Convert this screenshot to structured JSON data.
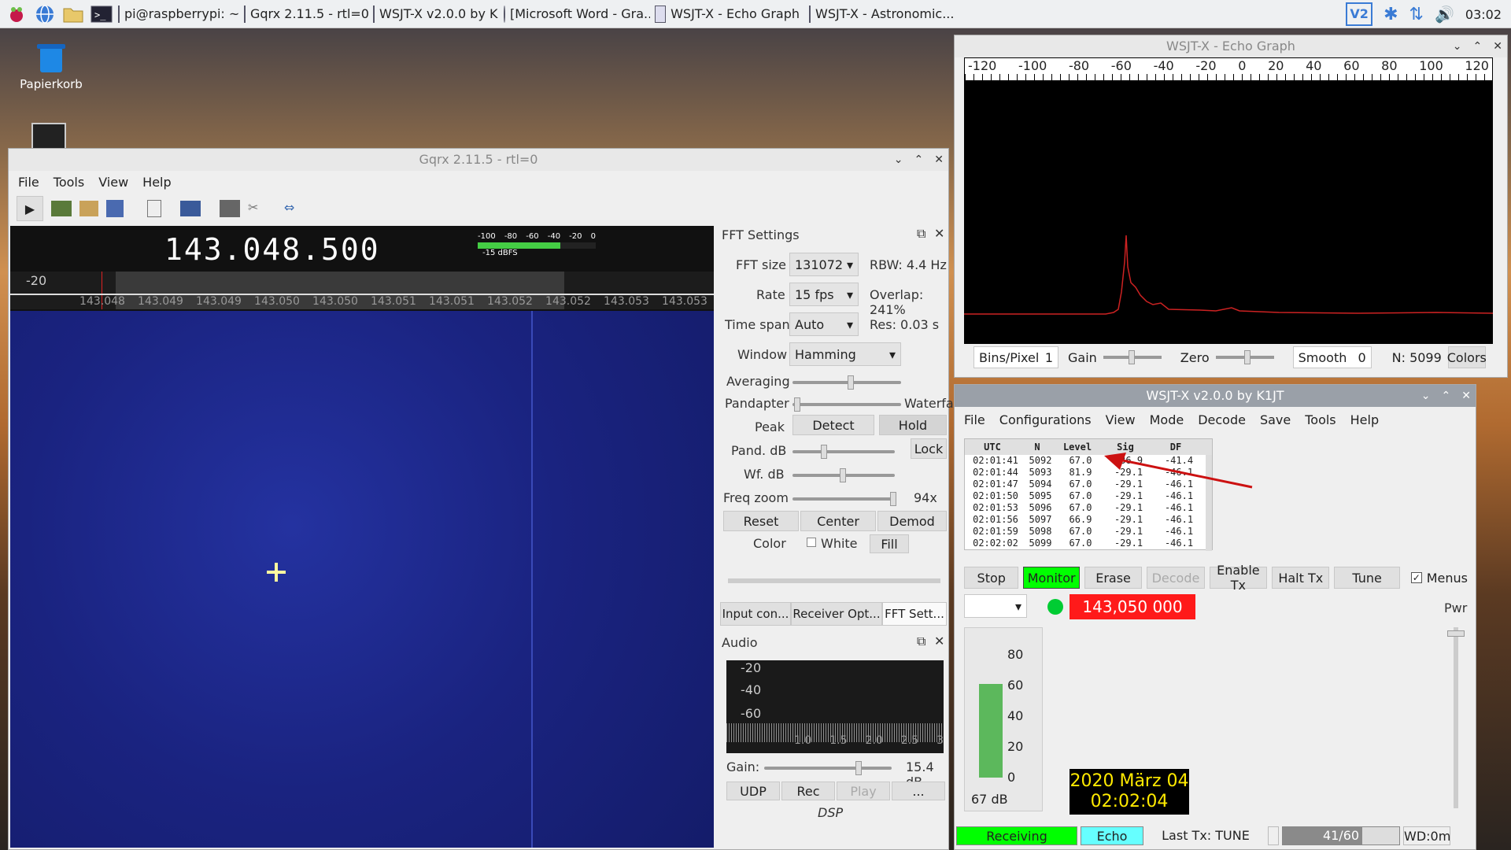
{
  "taskbar": {
    "tasks": [
      "pi@raspberrypi: ~",
      "Gqrx 2.11.5 - rtl=0",
      "WSJT-X   v2.0.0   by K...",
      "[Microsoft Word - Gra...",
      "WSJT-X - Echo Graph",
      "WSJT-X - Astronomic..."
    ],
    "clock": "03:02"
  },
  "desktop": {
    "trash_label": "Papierkorb"
  },
  "gqrx": {
    "title": "Gqrx 2.11.5 - rtl=0",
    "menu": [
      "File",
      "Tools",
      "View",
      "Help"
    ],
    "frequency": "143.048.500",
    "meter_scale": [
      "-100",
      "-80",
      "-60",
      "-40",
      "-20",
      "0"
    ],
    "meter_unit": "-15 dBFS",
    "plot_db": "-20",
    "freq_ticks": [
      "143.048",
      "143.049",
      "143.049",
      "143.050",
      "143.050",
      "143.051",
      "143.051",
      "143.052",
      "143.052",
      "143.053",
      "143.053"
    ],
    "fft": {
      "title": "FFT Settings",
      "fft_size_label": "FFT size",
      "fft_size": "131072",
      "rbw": "RBW: 4.4 Hz",
      "rate_label": "Rate",
      "rate": "15 fps",
      "overlap": "Overlap: 241%",
      "timespan_label": "Time span",
      "timespan": "Auto",
      "res": "Res: 0.03 s",
      "window_label": "Window",
      "window": "Hamming",
      "averaging_label": "Averaging",
      "pandapter_label": "Pandapter",
      "waterfall_label": "Waterfa",
      "peak_label": "Peak",
      "detect": "Detect",
      "hold": "Hold",
      "pand_db_label": "Pand. dB",
      "lock": "Lock",
      "wf_db_label": "Wf. dB",
      "freq_zoom_label": "Freq zoom",
      "freq_zoom": "94x",
      "reset": "Reset",
      "center": "Center",
      "demod": "Demod",
      "color_label": "Color",
      "white": "White",
      "fill": "Fill"
    },
    "tabs": [
      "Input con...",
      "Receiver Opt...",
      "FFT Sett..."
    ],
    "audio": {
      "title": "Audio",
      "db_ticks": [
        "-20",
        "-40",
        "-60"
      ],
      "khz_ticks": [
        "1.0",
        "1.5",
        "2.0",
        "2.5",
        "3"
      ],
      "gain_label": "Gain:",
      "gain_value": "15.4 dB",
      "udp": "UDP",
      "rec": "Rec",
      "play": "Play",
      "more": "...",
      "dsp": "DSP"
    }
  },
  "echo_graph": {
    "title": "WSJT-X - Echo Graph",
    "axis": [
      "-120",
      "-100",
      "-80",
      "-60",
      "-40",
      "-20",
      "0",
      "20",
      "40",
      "60",
      "80",
      "100",
      "120"
    ],
    "bins_label": "Bins/Pixel",
    "bins_value": "1",
    "gain_label": "Gain",
    "zero_label": "Zero",
    "smooth_label": "Smooth",
    "smooth_value": "0",
    "n_label": "N: 5099",
    "colors": "Colors"
  },
  "wsjtx": {
    "title": "WSJT-X   v2.0.0   by K1JT",
    "menu": [
      "File",
      "Configurations",
      "View",
      "Mode",
      "Decode",
      "Save",
      "Tools",
      "Help"
    ],
    "table_headers": [
      "UTC",
      "N",
      "Level",
      "Sig",
      "DF"
    ],
    "rows": [
      [
        "02:01:41",
        "5092",
        "67.0",
        "-36.9",
        "-41.4"
      ],
      [
        "02:01:44",
        "5093",
        "81.9",
        "-29.1",
        "-46.1"
      ],
      [
        "02:01:47",
        "5094",
        "67.0",
        "-29.1",
        "-46.1"
      ],
      [
        "02:01:50",
        "5095",
        "67.0",
        "-29.1",
        "-46.1"
      ],
      [
        "02:01:53",
        "5096",
        "67.0",
        "-29.1",
        "-46.1"
      ],
      [
        "02:01:56",
        "5097",
        "66.9",
        "-29.1",
        "-46.1"
      ],
      [
        "02:01:59",
        "5098",
        "67.0",
        "-29.1",
        "-46.1"
      ],
      [
        "02:02:02",
        "5099",
        "67.0",
        "-29.1",
        "-46.1"
      ]
    ],
    "buttons": {
      "stop": "Stop",
      "monitor": "Monitor",
      "erase": "Erase",
      "decode": "Decode",
      "enable_tx": "Enable Tx",
      "halt_tx": "Halt Tx",
      "tune": "Tune",
      "menus": "Menus"
    },
    "dial_freq": "143,050 000",
    "pwr_label": "Pwr",
    "meter_ticks": [
      "80",
      "60",
      "40",
      "20",
      "0"
    ],
    "meter_db": "67 dB",
    "meter_level": 0.67,
    "date": "2020 März 04",
    "time": "02:02:04",
    "status": {
      "receiving": "Receiving",
      "mode": "Echo",
      "last_tx": "Last Tx: TUNE",
      "progress": "41/60",
      "wd": "WD:0m"
    },
    "progress_fraction": 0.683
  },
  "colors": {
    "monitor_green": "#00ff00",
    "freq_red": "#ff1a1a",
    "echo_trace": "#cc2222",
    "waterfall": "#1a2a8a"
  }
}
